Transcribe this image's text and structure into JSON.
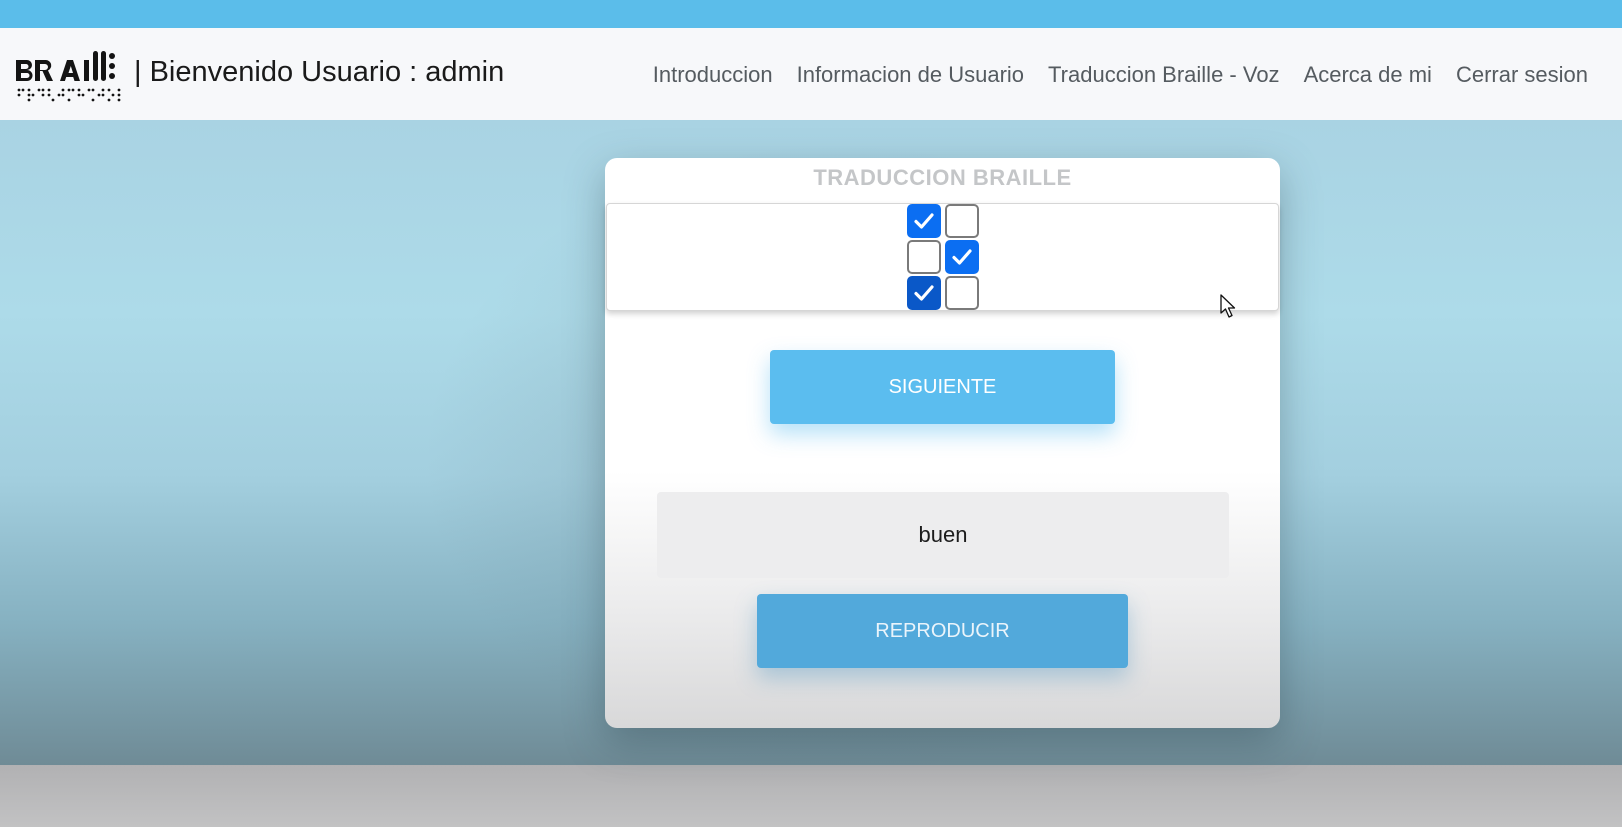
{
  "header": {
    "logo_text": "BRAILLE",
    "welcome": "| Bienvenido Usuario : admin",
    "nav": [
      {
        "label": "Introduccion"
      },
      {
        "label": "Informacion de Usuario"
      },
      {
        "label": "Traduccion Braille - Voz"
      },
      {
        "label": "Acerca de mi"
      },
      {
        "label": "Cerrar sesion"
      }
    ]
  },
  "card": {
    "title": "TRADUCCION BRAILLE",
    "braille_cell": {
      "dots": [
        {
          "label": "1",
          "checked": true
        },
        {
          "label": "4",
          "checked": false
        },
        {
          "label": "2",
          "checked": false
        },
        {
          "label": "5",
          "checked": true
        },
        {
          "label": "3",
          "checked": true
        },
        {
          "label": "6",
          "checked": false
        }
      ]
    },
    "next_button": "SIGUIENTE",
    "result_text": "buen",
    "play_button": "REPRODUCIR"
  },
  "colors": {
    "top_bar": "#5bbdea",
    "checked_blue": "#0b6ef2",
    "next_button": "#5bbdef",
    "play_button": "#52a9db"
  },
  "icons": [
    "braille-logo-icon",
    "checkmark-icon",
    "mouse-pointer-icon"
  ]
}
